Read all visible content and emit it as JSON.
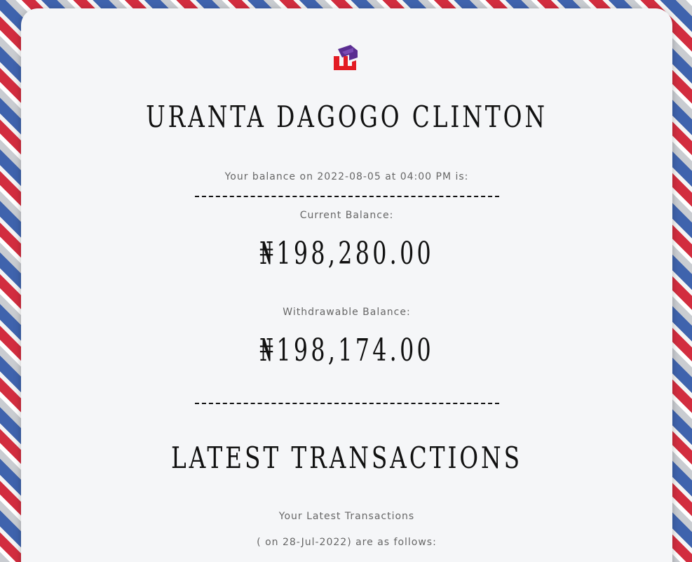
{
  "account": {
    "holder_name": "URANTA DAGOGO CLINTON",
    "balance_intro": "Your balance on 2022-08-05 at 04:00 PM is:"
  },
  "balances": {
    "current_label": "Current Balance:",
    "current_amount": "₦198,280.00",
    "withdrawable_label": "Withdrawable Balance:",
    "withdrawable_amount": "₦198,174.00"
  },
  "transactions": {
    "title": "LATEST TRANSACTIONS",
    "subtitle": "Your Latest Transactions",
    "date_line": "( on 28-Jul-2022) are as follows:"
  },
  "logo": {
    "icon": "brand-logo-icon",
    "colors": [
      "#5a2d91",
      "#e31b23"
    ]
  },
  "colors": {
    "card_background": "#f5f6f8",
    "text_primary": "#111111",
    "text_secondary": "#666666",
    "pattern_red": "#d22d3f",
    "pattern_blue": "#3f63ad"
  }
}
